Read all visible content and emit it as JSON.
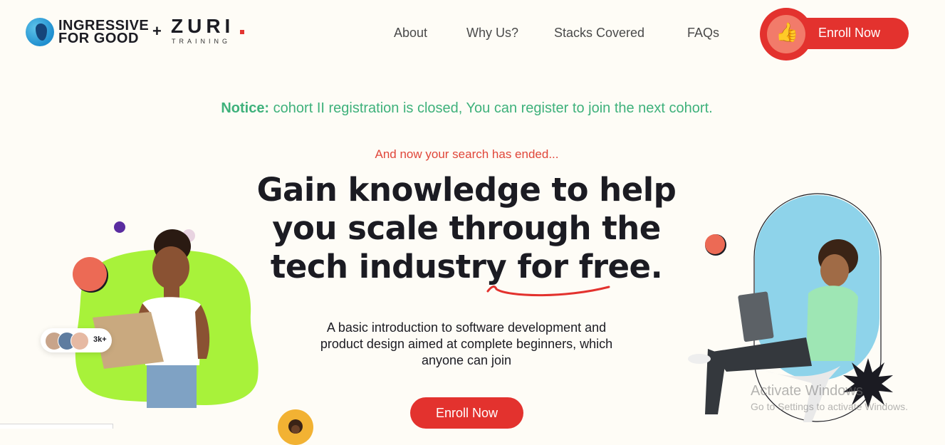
{
  "header": {
    "brand_line1": "INGRESSIVE",
    "brand_line2": "FOR GOOD",
    "brand_plus": "+",
    "brand_zuri": "ZURI",
    "brand_training": "TRAINING",
    "nav": [
      "About",
      "Why Us?",
      "Stacks Covered",
      "FAQs"
    ],
    "enroll_label": "Enroll Now"
  },
  "notice": {
    "label": "Notice:",
    "text": "cohort II registration is closed, You can register to join the next cohort."
  },
  "hero": {
    "tagline": "And now your search has ended...",
    "headline": "Gain knowledge to help you scale through the tech industry for free.",
    "subtext": "A basic introduction to software development and product design aimed at complete beginners, which anyone can join",
    "cta_label": "Enroll Now",
    "community_count": "3k+"
  },
  "watermark": {
    "title": "Activate Windows",
    "subtitle": "Go to Settings to activate Windows."
  },
  "colors": {
    "accent": "#e3322e",
    "notice": "#3eb17b",
    "blob": "#a8f23a",
    "sky": "#8ed3ea"
  }
}
